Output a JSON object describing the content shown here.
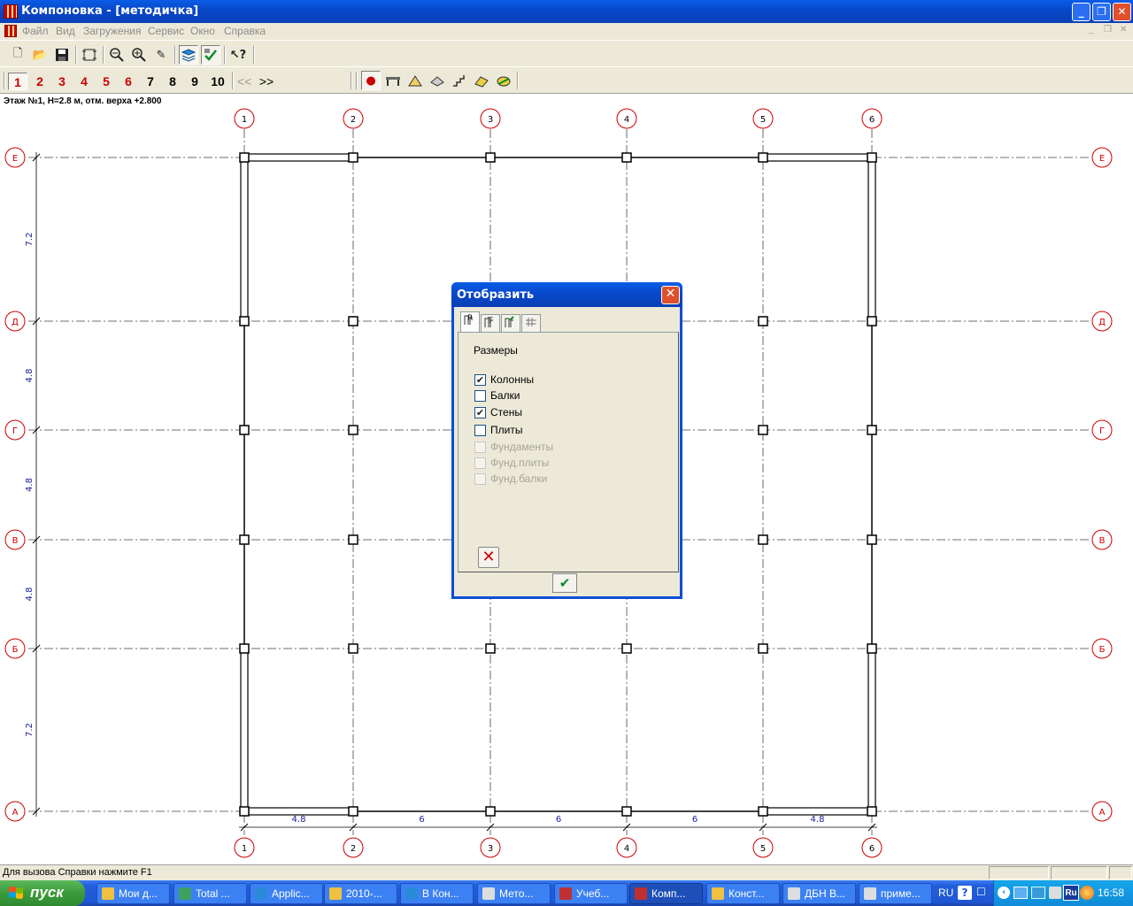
{
  "window": {
    "title": "Компоновка - [методичка]"
  },
  "menu": [
    "Файл",
    "Вид",
    "Загружения",
    "Сервис",
    "Окно",
    "Справка"
  ],
  "floors": {
    "labels": [
      "1",
      "2",
      "3",
      "4",
      "5",
      "6",
      "7",
      "8",
      "9",
      "10"
    ],
    "prev": "<<",
    "next": ">>",
    "selected": "1"
  },
  "floor_info": "Этаж №1, H=2.8 м, отм. верха +2.800",
  "plan": {
    "x_axes": [
      "1",
      "2",
      "3",
      "4",
      "5",
      "6"
    ],
    "y_axes": [
      "Е",
      "Д",
      "Г",
      "В",
      "Б",
      "А"
    ],
    "x_spans": [
      "4.8",
      "6",
      "6",
      "6",
      "4.8"
    ],
    "y_spans": [
      "7.2",
      "4.8",
      "4.8",
      "4.8",
      "7.2"
    ]
  },
  "dialog": {
    "title": "Отобразить",
    "group": "Размеры",
    "options": [
      {
        "label": "Колонны",
        "checked": true,
        "enabled": true
      },
      {
        "label": "Балки",
        "checked": false,
        "enabled": true
      },
      {
        "label": "Стены",
        "checked": true,
        "enabled": true
      },
      {
        "label": "Плиты",
        "checked": false,
        "enabled": true
      },
      {
        "label": "Фундаменты",
        "checked": false,
        "enabled": false
      },
      {
        "label": "Фунд.плиты",
        "checked": false,
        "enabled": false
      },
      {
        "label": "Фунд.балки",
        "checked": false,
        "enabled": false
      }
    ]
  },
  "status": "Для вызова Справки нажмите F1",
  "taskbar": {
    "start": "пуск",
    "tasks": [
      "Мои д...",
      "Total ...",
      "Applic...",
      "2010-...",
      "В Кон...",
      "Мето...",
      "Учеб...",
      "Комп...",
      "Конст...",
      "ДБН В...",
      "приме..."
    ],
    "lang": "RU",
    "lang_icon": "Ru",
    "time": "16:58"
  }
}
